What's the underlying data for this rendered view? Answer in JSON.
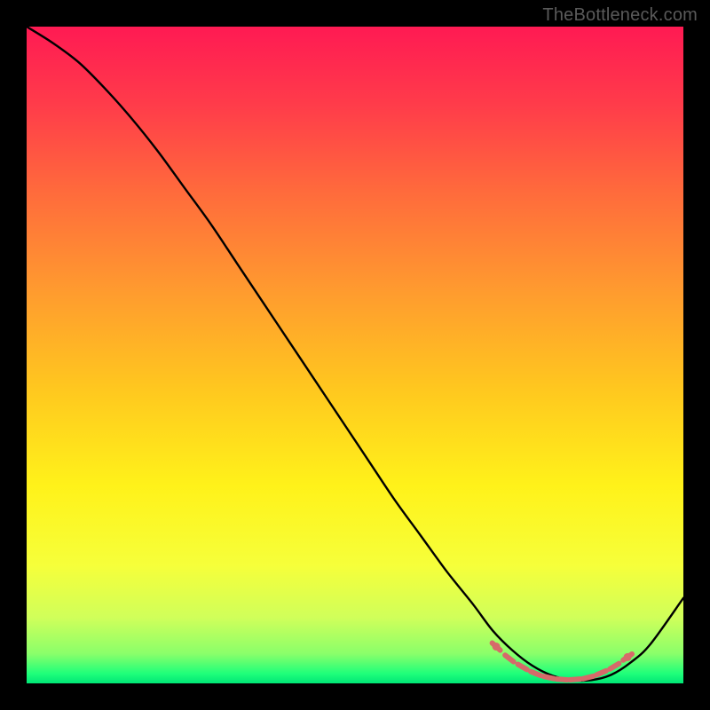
{
  "watermark": "TheBottleneck.com",
  "gradient": {
    "stops": [
      {
        "offset": 0.0,
        "color": "#ff1a53"
      },
      {
        "offset": 0.12,
        "color": "#ff3c4a"
      },
      {
        "offset": 0.25,
        "color": "#ff6a3c"
      },
      {
        "offset": 0.4,
        "color": "#ff9a2f"
      },
      {
        "offset": 0.55,
        "color": "#ffc71f"
      },
      {
        "offset": 0.7,
        "color": "#fff21a"
      },
      {
        "offset": 0.82,
        "color": "#f6ff3a"
      },
      {
        "offset": 0.9,
        "color": "#d0ff5a"
      },
      {
        "offset": 0.955,
        "color": "#8aff6a"
      },
      {
        "offset": 0.985,
        "color": "#1fff7a"
      },
      {
        "offset": 1.0,
        "color": "#00e676"
      }
    ]
  },
  "chart_data": {
    "type": "line",
    "title": "",
    "xlabel": "",
    "ylabel": "",
    "xlim": [
      0,
      100
    ],
    "ylim": [
      0,
      100
    ],
    "grid": false,
    "series": [
      {
        "name": "bottleneck-curve",
        "x": [
          0,
          4,
          8,
          12,
          16,
          20,
          24,
          28,
          32,
          36,
          40,
          44,
          48,
          52,
          56,
          60,
          64,
          68,
          71,
          74,
          77,
          80,
          83,
          86,
          89,
          92,
          95,
          100
        ],
        "y": [
          100,
          97.5,
          94.5,
          90.5,
          86,
          81,
          75.5,
          70,
          64,
          58,
          52,
          46,
          40,
          34,
          28,
          22.5,
          17,
          12,
          8,
          5,
          2.7,
          1.2,
          0.5,
          0.5,
          1.3,
          3.2,
          6,
          13
        ]
      }
    ],
    "markers": {
      "name": "optimal-range-markers",
      "color": "#d66a6a",
      "x": [
        71.5,
        73.5,
        75.5,
        77.5,
        79.5,
        81.5,
        83.5,
        85.5,
        87.5,
        89.5,
        91.5
      ],
      "y": [
        5.6,
        3.8,
        2.5,
        1.5,
        0.9,
        0.6,
        0.6,
        0.9,
        1.6,
        2.6,
        4.0
      ]
    }
  }
}
